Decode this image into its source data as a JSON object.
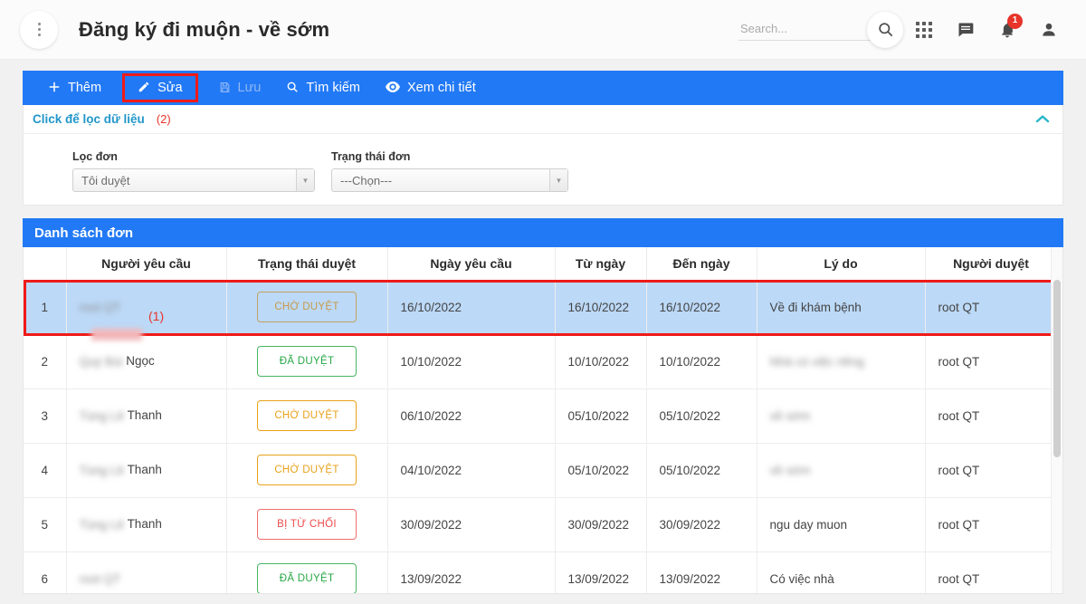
{
  "header": {
    "title": "Đăng ký đi muộn - về sớm",
    "menu_icon": "three-dots-vertical-icon",
    "search": {
      "placeholder": "Search...",
      "value": ""
    },
    "icons": {
      "search": "search-icon",
      "apps": "apps-grid-icon",
      "messages": "chat-icon",
      "notifications": "bell-icon",
      "account": "user-icon"
    },
    "notification_count": "1"
  },
  "toolbar": {
    "buttons": [
      {
        "icon": "plus-icon",
        "glyph": "+",
        "label": "Thêm",
        "disabled": false,
        "highlighted": false
      },
      {
        "icon": "pencil-icon",
        "glyph": "✏",
        "label": "Sửa",
        "disabled": false,
        "highlighted": true
      },
      {
        "icon": "save-icon",
        "glyph": "💾",
        "label": "Lưu",
        "disabled": true,
        "highlighted": false
      },
      {
        "icon": "search-icon",
        "glyph": "🔍",
        "label": "Tìm kiếm",
        "disabled": false,
        "highlighted": false
      },
      {
        "icon": "eye-icon",
        "glyph": "👁",
        "label": "Xem chi tiết",
        "disabled": false,
        "highlighted": false
      }
    ]
  },
  "filter": {
    "link_label": "Click để lọc dữ liệu",
    "annotation": "(2)",
    "collapse_icon": "chevron-up-icon",
    "fields": [
      {
        "label": "Lọc đơn",
        "value": "Tôi duyệt",
        "name": "loc-don-select"
      },
      {
        "label": "Trạng thái đơn",
        "value": "---Chọn---",
        "name": "trang-thai-don-select"
      }
    ]
  },
  "list": {
    "title": "Danh sách đơn",
    "annotation_row1": "(1)",
    "columns": [
      "",
      "Người yêu cầu",
      "Trạng thái duyệt",
      "Ngày yêu cầu",
      "Từ ngày",
      "Đến ngày",
      "Lý do",
      "Người duyệt"
    ],
    "rows": [
      {
        "idx": "1",
        "requester": "",
        "requester_redacted": "root QT",
        "status": "CHỜ DUYỆT",
        "status_kind": "pending",
        "request_date": "16/10/2022",
        "from_date": "16/10/2022",
        "to_date": "16/10/2022",
        "reason": "Về đi khám bệnh",
        "reason_redacted": "",
        "approver": "root QT",
        "highlighted": true
      },
      {
        "idx": "2",
        "requester": "Ngọc",
        "requester_redacted": "Quý Bùi",
        "status": "ĐÃ DUYỆT",
        "status_kind": "approved",
        "request_date": "10/10/2022",
        "from_date": "10/10/2022",
        "to_date": "10/10/2022",
        "reason": "",
        "reason_redacted": "Nhà có việc riêng",
        "approver": "root QT",
        "highlighted": false
      },
      {
        "idx": "3",
        "requester": "Thanh",
        "requester_redacted": "Tùng Lê",
        "status": "CHỜ DUYỆT",
        "status_kind": "pending",
        "request_date": "06/10/2022",
        "from_date": "05/10/2022",
        "to_date": "05/10/2022",
        "reason": "",
        "reason_redacted": "về sớm",
        "approver": "root QT",
        "highlighted": false
      },
      {
        "idx": "4",
        "requester": "Thanh",
        "requester_redacted": "Tùng Lê",
        "status": "CHỜ DUYỆT",
        "status_kind": "pending",
        "request_date": "04/10/2022",
        "from_date": "05/10/2022",
        "to_date": "05/10/2022",
        "reason": "",
        "reason_redacted": "về sớm",
        "approver": "root QT",
        "highlighted": false
      },
      {
        "idx": "5",
        "requester": "Thanh",
        "requester_redacted": "Tùng Lê",
        "status": "BỊ TỪ CHỐI",
        "status_kind": "rejected",
        "request_date": "30/09/2022",
        "from_date": "30/09/2022",
        "to_date": "30/09/2022",
        "reason": "ngu day muon",
        "reason_redacted": "",
        "approver": "root QT",
        "highlighted": false
      },
      {
        "idx": "6",
        "requester": "",
        "requester_redacted": "root QT",
        "status": "ĐÃ DUYỆT",
        "status_kind": "approved",
        "request_date": "13/09/2022",
        "from_date": "13/09/2022",
        "to_date": "13/09/2022",
        "reason": "Có việc nhà",
        "reason_redacted": "",
        "approver": "root QT",
        "highlighted": false
      }
    ]
  },
  "colors": {
    "primary_blue": "#2279f5",
    "annotation_red": "#ef1b19",
    "link_teal": "#2196c9",
    "row_highlight": "#bcd9f7",
    "status_pending": "#e9a21b",
    "status_approved": "#27a745",
    "status_rejected": "#ee4b4b",
    "badge_red": "#e8342a"
  }
}
